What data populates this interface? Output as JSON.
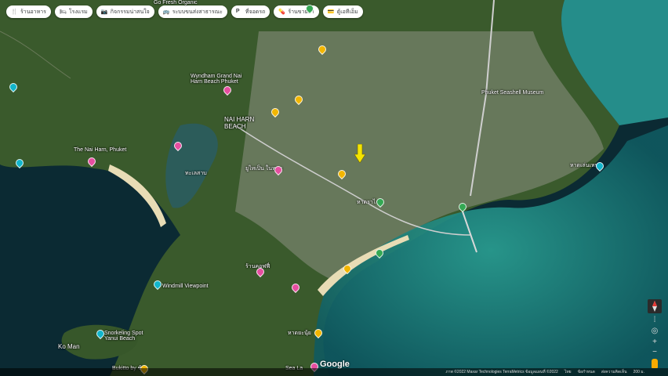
{
  "chips": [
    {
      "label": "ร้านอาหาร",
      "icon": "restaurant-icon"
    },
    {
      "label": "โรงแรม",
      "icon": "hotel-icon"
    },
    {
      "label": "กิจกรรมน่าสนใจ",
      "icon": "camera-icon"
    },
    {
      "label": "ระบบขนส่งสาธารณะ",
      "icon": "transit-icon"
    },
    {
      "label": "ที่จอดรถ",
      "icon": "parking-icon"
    },
    {
      "label": "ร้านขายยา",
      "icon": "pharmacy-icon"
    },
    {
      "label": "ตู้เอทีเอ็ม",
      "icon": "atm-icon"
    }
  ],
  "labels": {
    "go_fresh": "Go Fresh Organic",
    "wyndham": "Wyndham Grand Nai Harn Beach Phuket",
    "nai_harn_beach": "NAI HARN BEACH",
    "the_nai_harn": "The Nai Harn, Phuket",
    "seashell": "Phuket Seashell Museum",
    "windmill": "Windmill Viewpoint",
    "snorkeling": "Snorkeling Spot Yanui Beach",
    "ko_man": "Ko Man",
    "bukitto": "Bukitto by ช้าง",
    "sea_la": "Sea La",
    "thai_1": "ทะเลสาบ",
    "thai_2": "หาดราไวย์",
    "thai_3": "ร้านคอฟฟี่",
    "thai_4": "หาดยะนุ้ย",
    "thai_5": "ยูไทเป็น ในหาน",
    "thai_6": "หาดเล่นเหนท"
  },
  "branding": "Google",
  "attribution": {
    "imagery": "ภาพ ©2022 Maxar Technologies TerraMetrics ข้อมูลแผนที่ ©2022",
    "terms": "ไทย",
    "privacy": "ข้อกำหนด",
    "feedback": "ส่งความคิดเห็น",
    "scale": "200 ม."
  },
  "colors": {
    "sea": "#0b2a33",
    "shallow": "#1e8d86",
    "land": "#3a5a2c",
    "urban": "#8c9284",
    "marker_yellow": "#f4c430",
    "pin_orange": "#f2b600",
    "pin_pink": "#e64ea0",
    "pin_teal": "#12b5cb",
    "pin_green": "#34a853"
  }
}
